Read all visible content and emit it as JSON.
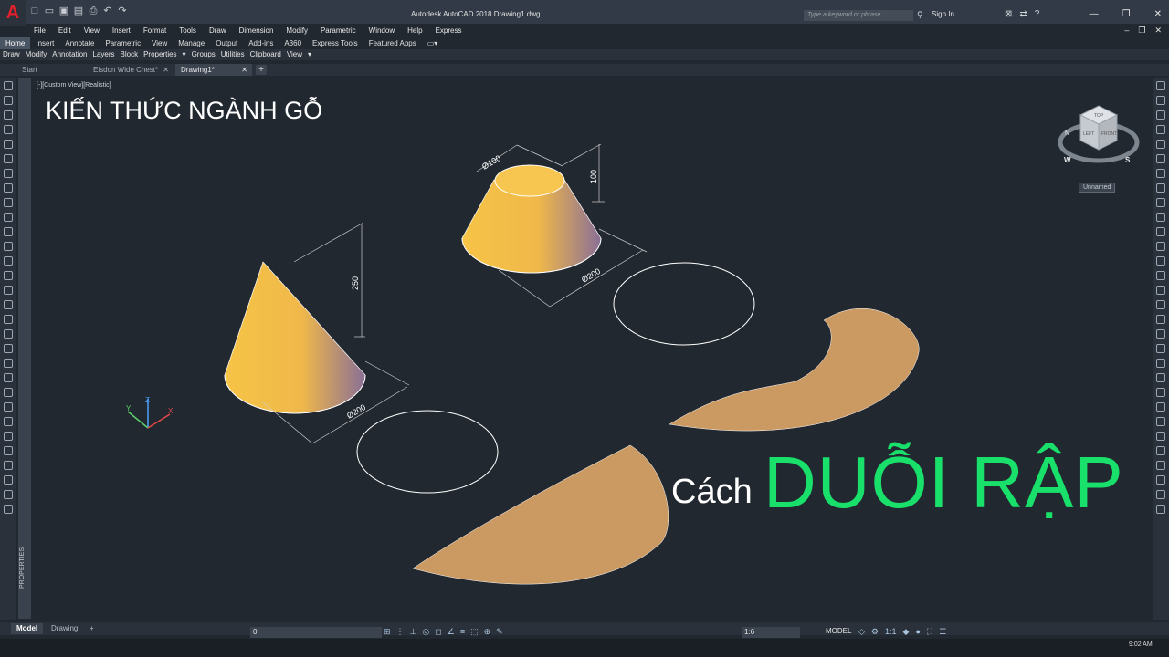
{
  "app": {
    "logo": "A",
    "window_title": "Autodesk AutoCAD 2018    Drawing1.dwg",
    "search_placeholder": "Type a keyword or phrase",
    "sign_in": "Sign In"
  },
  "menu": [
    "File",
    "Edit",
    "View",
    "Insert",
    "Format",
    "Tools",
    "Draw",
    "Dimension",
    "Modify",
    "Parametric",
    "Window",
    "Help",
    "Express"
  ],
  "ribbon_tabs": [
    "Home",
    "Insert",
    "Annotate",
    "Parametric",
    "View",
    "Manage",
    "Output",
    "Add-ins",
    "A360",
    "Express Tools",
    "Featured Apps"
  ],
  "ribbon_panels": [
    "Draw",
    "Modify",
    "Annotation",
    "Layers",
    "Block",
    "Properties",
    "Groups",
    "Utilities",
    "Clipboard",
    "View"
  ],
  "doc_tabs": [
    "Start",
    "Elsdon Wide Chest*",
    "Drawing1*"
  ],
  "viewport_label": "[-][Custom View][Realistic]",
  "viewcube": {
    "top": "TOP",
    "left": "LEFT",
    "front": "FRONT",
    "compass_w": "W",
    "compass_s": "S",
    "compass_n": "N",
    "ucs_label": "Unnamed"
  },
  "overlay": {
    "headline": "KIẾN THỨC NGÀNH GỖ",
    "cach": "Cách",
    "duoi_rap": "DUỖI  RẬP",
    "accent_green": "#19e06a"
  },
  "dimensions": {
    "big_cone_height": "250",
    "big_cone_base": "Ø200",
    "frustum_top": "Ø100",
    "frustum_height": "100",
    "frustum_base": "Ø200"
  },
  "palette_label": "PROPERTIES",
  "layout_tabs": [
    "Model",
    "Drawing"
  ],
  "status": {
    "layer": "0",
    "scale": "1:6",
    "model": "MODEL",
    "annot_scale": "1:1",
    "clock": "9:02 AM"
  },
  "colors": {
    "cone_fill_light": "#f4c043",
    "cone_fill_dark": "#8d7294",
    "flat_pattern": "#cb9a62",
    "canvas": "#212830"
  }
}
